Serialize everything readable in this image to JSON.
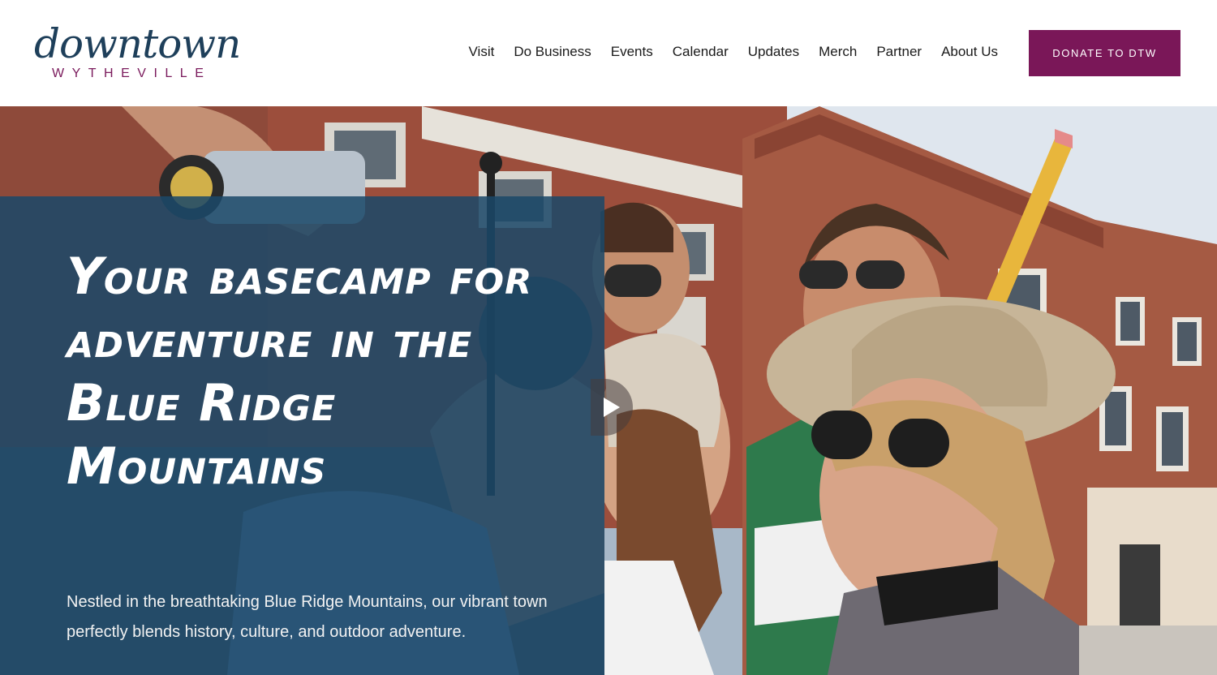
{
  "logo": {
    "script_text": "downtown",
    "sub_text": "WYTHEVILLE",
    "script_color": "#1e3f5a",
    "sub_color": "#7a1a5c"
  },
  "nav": {
    "items": [
      "Visit",
      "Do Business",
      "Events",
      "Calendar",
      "Updates",
      "Merch",
      "Partner",
      "About Us"
    ]
  },
  "donate_button": {
    "label": "DONATE TO DTW",
    "color": "#7a1758"
  },
  "hero": {
    "headline": "Your basecamp for adventure in the Blue Ridge Mountains",
    "subtext": "Nestled in the breathtaking Blue Ridge Mountains, our vibrant town perfectly blends history, culture, and outdoor adventure.",
    "overlay_color": "#1b4869",
    "play_icon": "play-icon"
  }
}
